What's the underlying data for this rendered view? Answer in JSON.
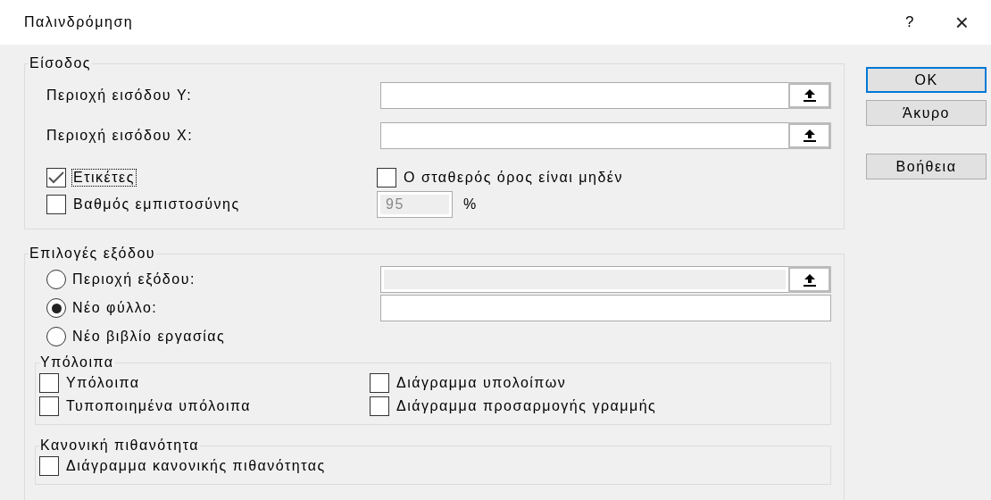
{
  "window": {
    "title": "Παλινδρόμηση",
    "help": "?",
    "close": "×"
  },
  "input_group": {
    "title": "Είσοδος",
    "ranges": [
      {
        "label": "Περιοχή εισόδου Y:"
      },
      {
        "label": "Περιοχή εισόδου X:"
      }
    ],
    "labels": {
      "label": "Ετικέτες",
      "checked": true,
      "focused": true
    },
    "constant_zero": {
      "label": "Ο σταθερός όρος είναι μηδέν",
      "checked": false,
      "focused": false
    },
    "confidence": {
      "label": "Βαθμός εμπιστοσύνης",
      "checked": false,
      "focused": false,
      "value": "95",
      "disabled": true,
      "unit": "%"
    }
  },
  "buttons": [
    {
      "label": "OK",
      "default": true
    },
    {
      "label": "Άκυρο",
      "default": false
    },
    {
      "label": "Βοήθεια",
      "default": false
    }
  ],
  "output_group": {
    "title": "Επιλογές εξόδου",
    "options": [
      {
        "label": "Περιοχή εξόδου:",
        "selected": false,
        "field": {
          "disabled": true,
          "picker": true
        }
      },
      {
        "label": "Νέο φύλλο:",
        "selected": true,
        "field": {
          "disabled": false,
          "picker": false
        }
      },
      {
        "label": "Νέο βιβλίο εργασίας",
        "selected": false
      }
    ],
    "residuals": {
      "title": "Υπόλοιπα",
      "items": [
        {
          "label": "Υπόλοιπα",
          "checked": false
        },
        {
          "label": "Διάγραμμα υπολοίπων",
          "checked": false
        },
        {
          "label": "Τυποποιημένα υπόλοιπα",
          "checked": false
        },
        {
          "label": "Διάγραμμα προσαρμογής γραμμής",
          "checked": false
        }
      ]
    },
    "normal": {
      "title": "Κανονική πιθανότητα",
      "items": [
        {
          "label": "Διάγραμμα κανονικής πιθανότητας",
          "checked": false
        }
      ]
    }
  }
}
